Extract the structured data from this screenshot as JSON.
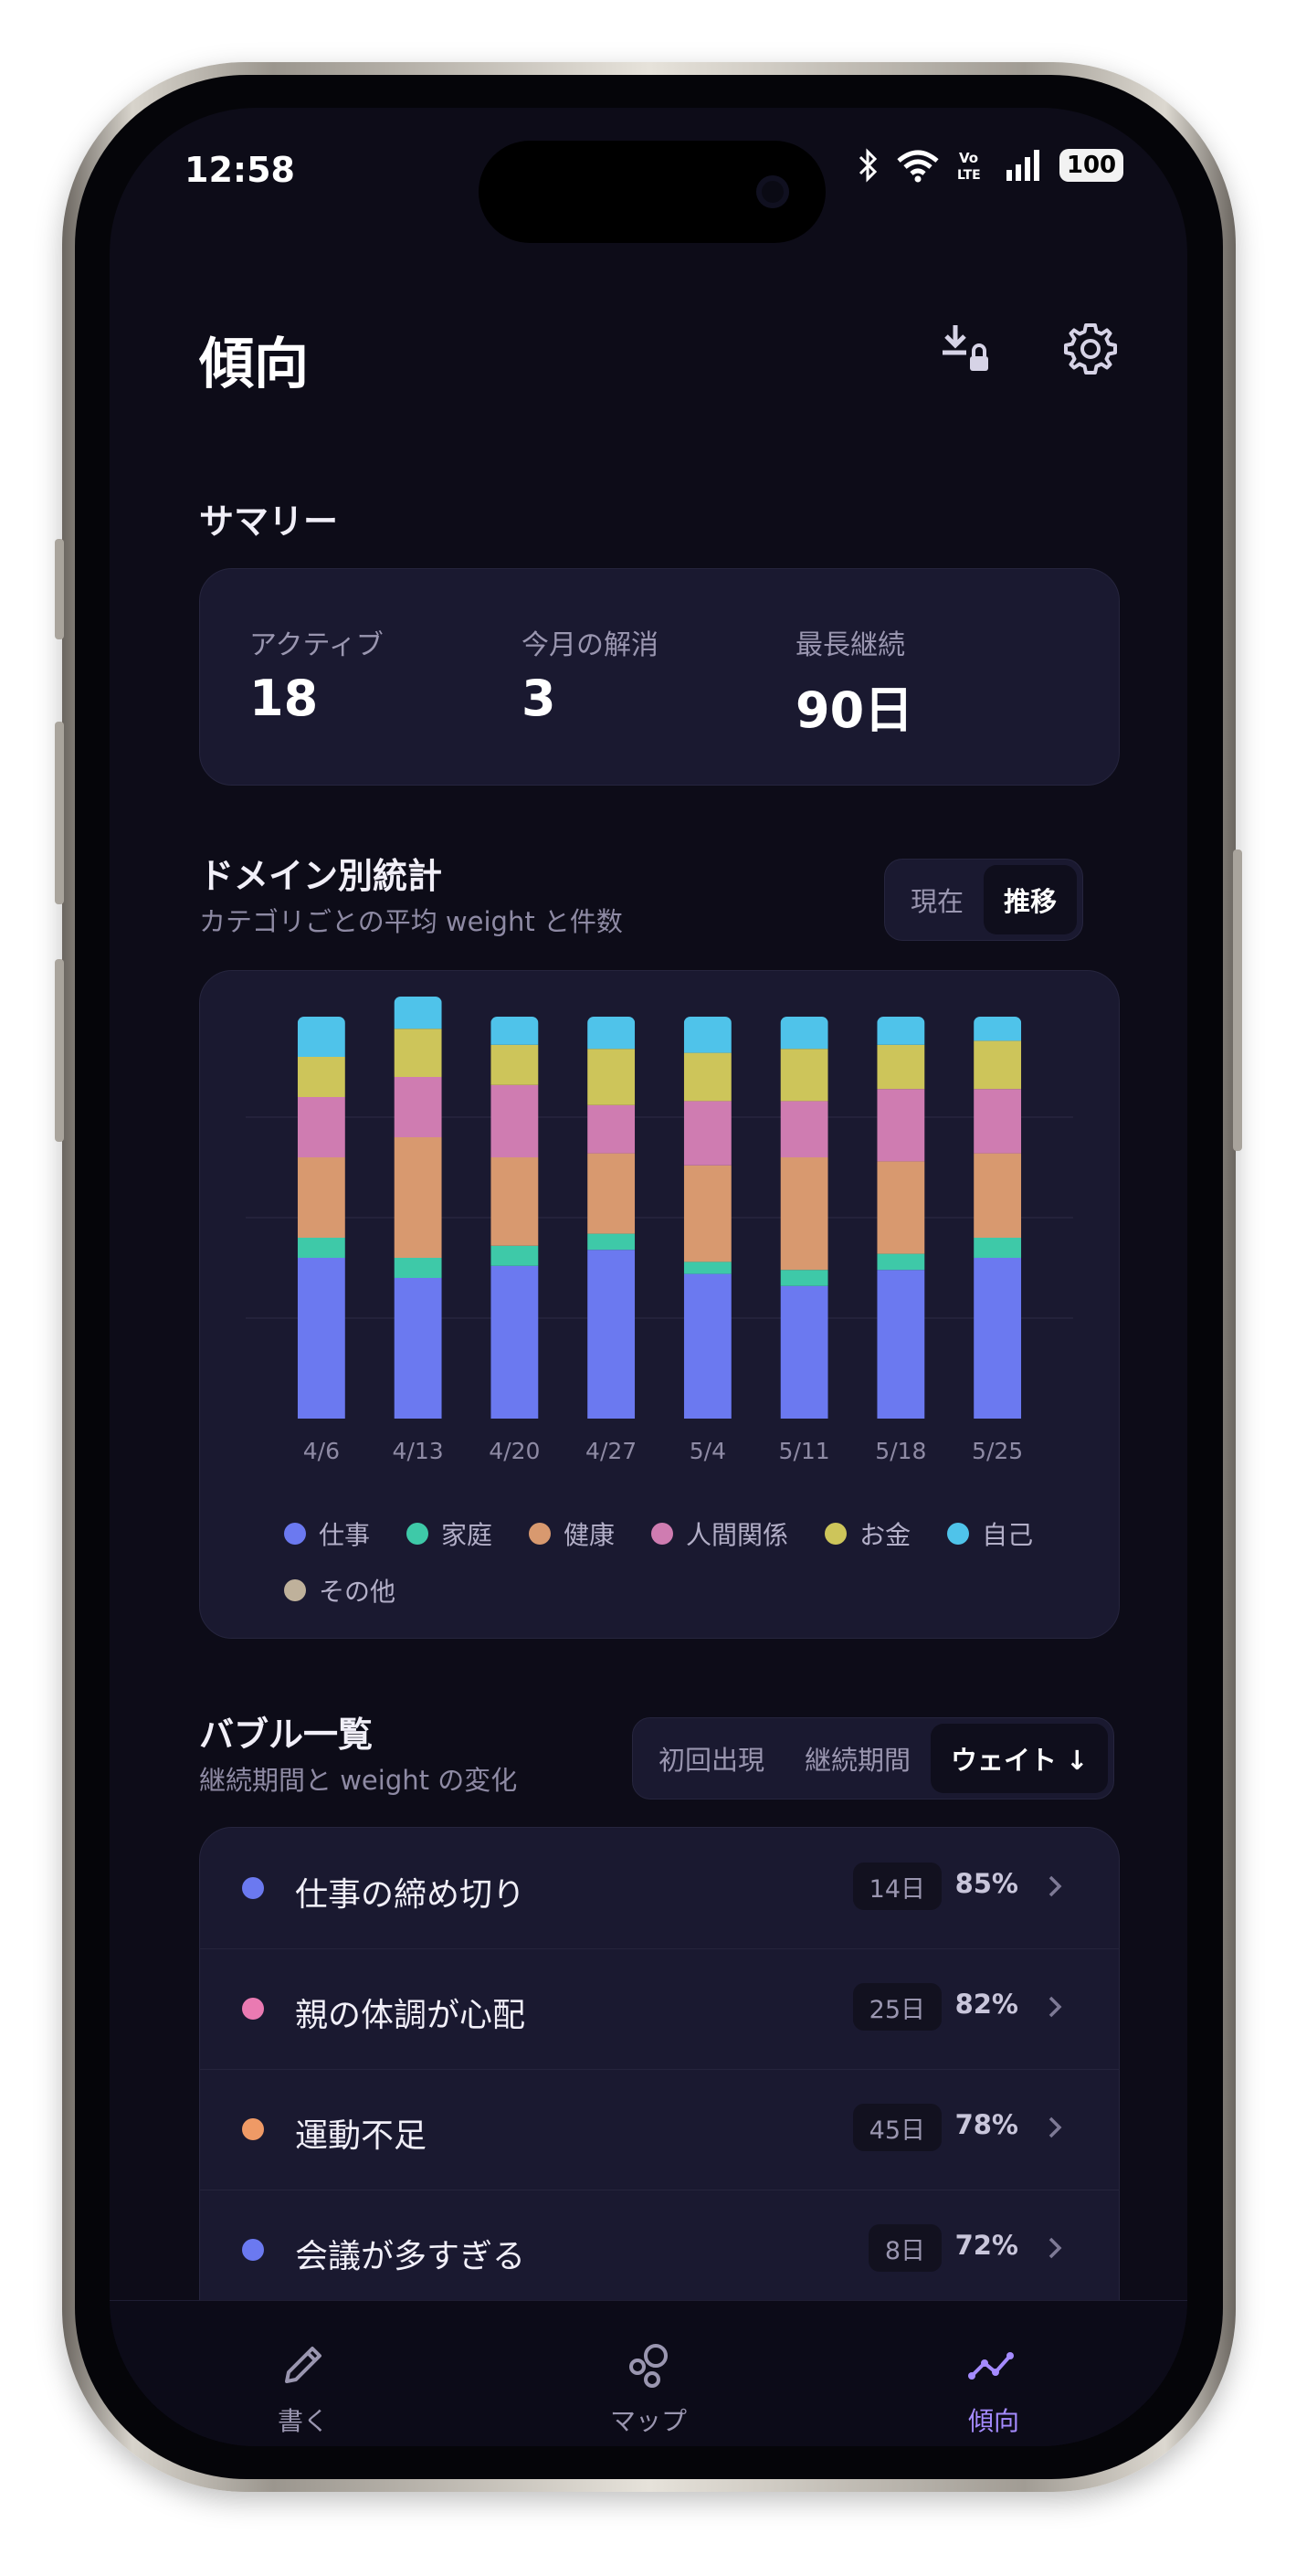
{
  "status_bar": {
    "time": "12:58",
    "battery": "100"
  },
  "header": {
    "title": "傾向",
    "export_icon": "download-lock-icon",
    "settings_icon": "gear-icon"
  },
  "summary": {
    "title": "サマリー",
    "stats": [
      {
        "label": "アクティブ",
        "value": "18"
      },
      {
        "label": "今月の解消",
        "value": "3"
      },
      {
        "label": "最長継続",
        "value": "90日"
      }
    ]
  },
  "domain_stats": {
    "title": "ドメイン別統計",
    "subtitle": "カテゴリごとの平均 weight と件数",
    "toggle": {
      "options": [
        "現在",
        "推移"
      ],
      "selected": "推移"
    }
  },
  "chart_data": {
    "type": "bar",
    "stacked": true,
    "categories": [
      "4/6",
      "4/13",
      "4/20",
      "4/27",
      "5/4",
      "5/11",
      "5/18",
      "5/25"
    ],
    "series": [
      {
        "name": "仕事",
        "color": "#6b79f0",
        "values": [
          40,
          35,
          38,
          42,
          36,
          33,
          37,
          40
        ]
      },
      {
        "name": "家庭",
        "color": "#3ec9a8",
        "values": [
          5,
          5,
          5,
          4,
          3,
          4,
          4,
          5
        ]
      },
      {
        "name": "健康",
        "color": "#d8996f",
        "values": [
          20,
          30,
          22,
          20,
          24,
          28,
          23,
          21
        ]
      },
      {
        "name": "人間関係",
        "color": "#cf7cb1",
        "values": [
          15,
          15,
          18,
          12,
          16,
          14,
          18,
          16
        ]
      },
      {
        "name": "お金",
        "color": "#cdc55a",
        "values": [
          10,
          12,
          10,
          14,
          12,
          13,
          11,
          12
        ]
      },
      {
        "name": "自己",
        "color": "#4fc3ea",
        "values": [
          10,
          8,
          7,
          8,
          9,
          8,
          7,
          6
        ]
      },
      {
        "name": "その他",
        "color": "#bfb19b",
        "values": [
          0,
          0,
          0,
          0,
          0,
          0,
          0,
          0
        ]
      }
    ],
    "ylim": [
      0,
      100
    ],
    "grid": true,
    "legend_position": "bottom"
  },
  "bubble_list": {
    "title": "バブル一覧",
    "subtitle": "継続期間と weight の変化",
    "sort": {
      "options": [
        "初回出現",
        "継続期間",
        "ウェイト ↓"
      ],
      "selected": "ウェイト ↓"
    },
    "items": [
      {
        "name": "仕事の締め切り",
        "duration": "14日",
        "weight": "85%",
        "color": "#6b79f0"
      },
      {
        "name": "親の体調が心配",
        "duration": "25日",
        "weight": "82%",
        "color": "#ea7ab2"
      },
      {
        "name": "運動不足",
        "duration": "45日",
        "weight": "78%",
        "color": "#ef9a66"
      },
      {
        "name": "会議が多すぎる",
        "duration": "8日",
        "weight": "72%",
        "color": "#6b79f0"
      }
    ]
  },
  "bottom_nav": {
    "items": [
      {
        "label": "書く",
        "icon": "pencil-icon"
      },
      {
        "label": "マップ",
        "icon": "bubbles-icon"
      },
      {
        "label": "傾向",
        "icon": "trend-line-icon",
        "active": true
      }
    ]
  }
}
